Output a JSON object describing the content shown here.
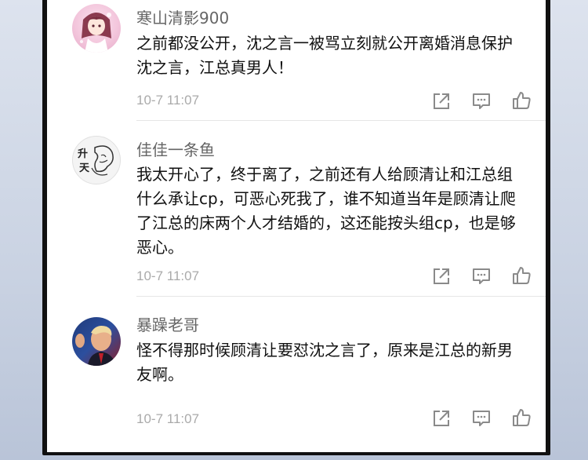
{
  "comments": [
    {
      "username": "寒山清影900",
      "text": "之前都没公开，沈之言一被骂立刻就公开离婚消息保护沈之言，江总真男人！",
      "time": "10-7 11:07",
      "avatar": "anime-girl-avatar"
    },
    {
      "username": "佳佳一条鱼",
      "text": "我太开心了，终于离了，之前还有人给顾清让和江总组什么承让cp，可恶心死我了，谁不知道当年是顾清让爬了江总的床两个人才结婚的，这还能按头组cp，也是够恶心。",
      "time": "10-7 11:07",
      "avatar": "sketch-avatar",
      "avatar_text": "升天"
    },
    {
      "username": "暴躁老哥",
      "text": "怪不得那时候顾清让要怼沈之言了，原来是江总的新男友啊。",
      "time": "10-7 11:07",
      "avatar": "man-photo-avatar"
    }
  ],
  "icons": {
    "share": "share-icon",
    "reply": "comment-icon",
    "like": "thumbs-up-icon"
  },
  "colors": {
    "username": "#666666",
    "text": "#111111",
    "timestamp": "#aaaaaa",
    "icon": "#8a8a8a"
  }
}
